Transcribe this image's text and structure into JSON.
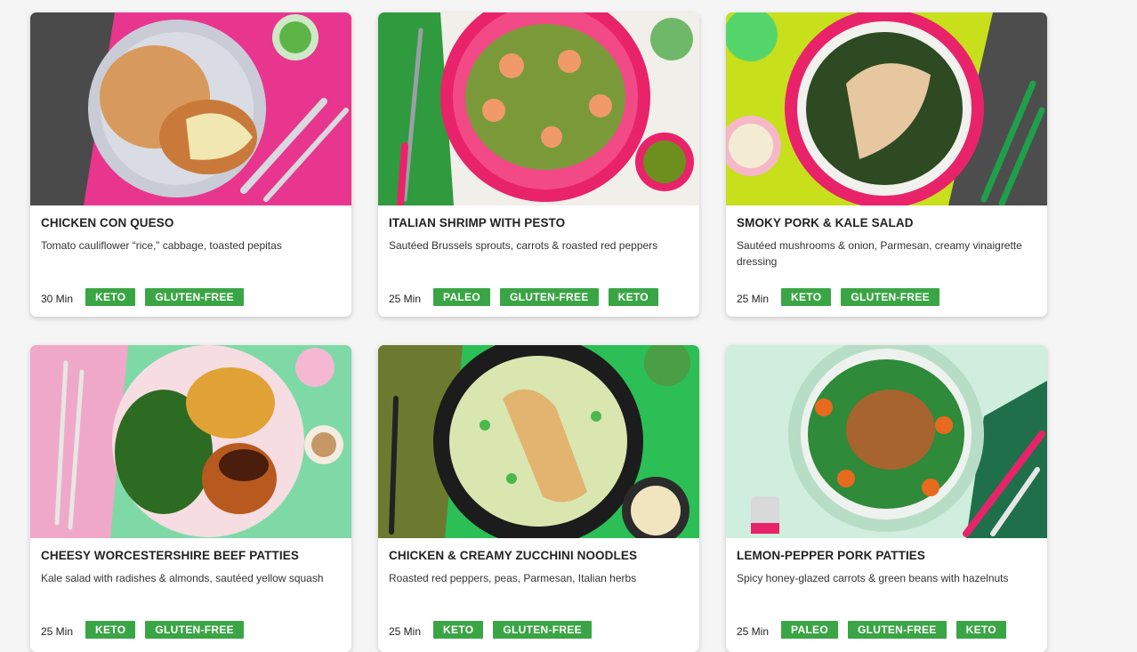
{
  "recipes": [
    {
      "title": "CHICKEN CON QUESO",
      "description": "Tomato cauliflower “rice,” cabbage, toasted pepitas",
      "time": "30 Min",
      "tags": [
        "KETO",
        "GLUTEN-FREE"
      ],
      "image_name": "chicken-con-queso-photo"
    },
    {
      "title": "ITALIAN SHRIMP WITH PESTO",
      "description": "Sautéed Brussels sprouts, carrots & roasted red peppers",
      "time": "25 Min",
      "tags": [
        "PALEO",
        "GLUTEN-FREE",
        "KETO"
      ],
      "image_name": "italian-shrimp-pesto-photo"
    },
    {
      "title": "SMOKY PORK & KALE SALAD",
      "description": "Sautéed mushrooms & onion, Parmesan, creamy vinaigrette dressing",
      "time": "25 Min",
      "tags": [
        "KETO",
        "GLUTEN-FREE"
      ],
      "image_name": "smoky-pork-kale-salad-photo"
    },
    {
      "title": "CHEESY WORCESTERSHIRE BEEF PATTIES",
      "description": "Kale salad with radishes & almonds, sautéed yellow squash",
      "time": "25 Min",
      "tags": [
        "KETO",
        "GLUTEN-FREE"
      ],
      "image_name": "beef-patties-photo"
    },
    {
      "title": "CHICKEN & CREAMY ZUCCHINI NOODLES",
      "description": "Roasted red peppers, peas, Parmesan, Italian herbs",
      "time": "25 Min",
      "tags": [
        "KETO",
        "GLUTEN-FREE"
      ],
      "image_name": "chicken-zucchini-noodles-photo"
    },
    {
      "title": "LEMON-PEPPER PORK PATTIES",
      "description": "Spicy honey-glazed carrots & green beans with hazelnuts",
      "time": "25 Min",
      "tags": [
        "PALEO",
        "GLUTEN-FREE",
        "KETO"
      ],
      "image_name": "pork-patties-photo"
    }
  ],
  "colors": {
    "tag_bg": "#3aa544",
    "tag_text": "#ffffff",
    "card_bg": "#ffffff",
    "page_bg": "#f5f5f5"
  }
}
